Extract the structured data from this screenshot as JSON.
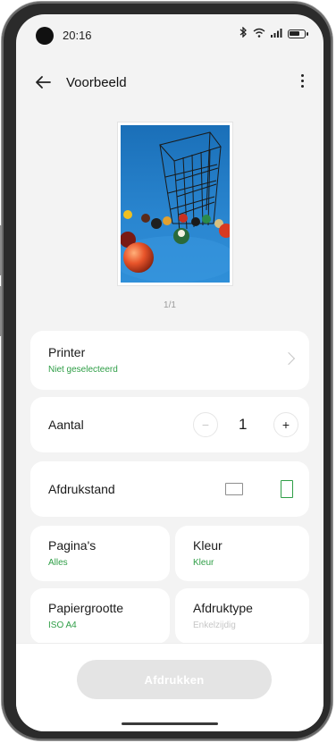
{
  "status_bar": {
    "time": "20:16",
    "icons": [
      "bluetooth-icon",
      "wifi-icon",
      "signal-icon",
      "battery-icon"
    ]
  },
  "header": {
    "title": "Voorbeeld",
    "back_icon": "arrow-left-icon",
    "menu_icon": "more-vert-icon"
  },
  "preview": {
    "page_count": "1/1",
    "image": "photo of a metal wire cage over billiard balls on blue background"
  },
  "printer": {
    "label": "Printer",
    "status": "Niet geselecteerd"
  },
  "copies": {
    "label": "Aantal",
    "value": "1",
    "minus": "−",
    "plus": "+"
  },
  "orientation": {
    "label": "Afdrukstand",
    "selected": "portrait"
  },
  "pages": {
    "label": "Pagina's",
    "value": "Alles"
  },
  "color": {
    "label": "Kleur",
    "value": "Kleur"
  },
  "paper": {
    "label": "Papiergrootte",
    "value": "ISO A4"
  },
  "print_type": {
    "label": "Afdruktype",
    "value": "Enkelzijdig"
  },
  "action": {
    "print_label": "Afdrukken"
  },
  "colors": {
    "accent": "#2e9e46",
    "card": "#ffffff",
    "background": "#f3f3f3"
  }
}
